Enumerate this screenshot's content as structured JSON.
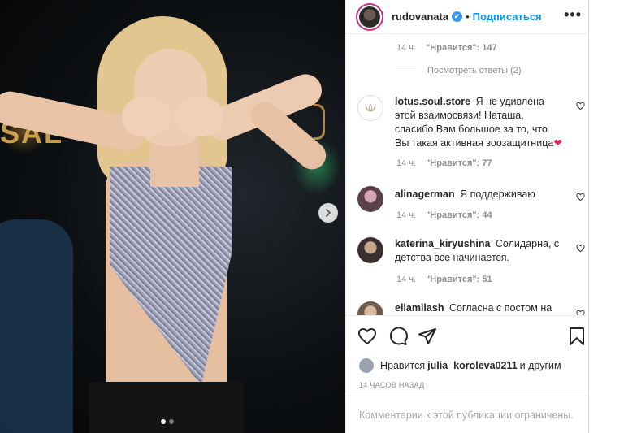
{
  "post": {
    "username": "rudovanata",
    "follow_label": "Подписаться",
    "separator": "•",
    "more_label": "•••",
    "verified_mark": "✔"
  },
  "photo": {
    "sign_text": "SAL",
    "carousel": {
      "count": 2,
      "active_index": 0
    }
  },
  "thread": {
    "first_meta": {
      "time": "14 ч.",
      "likes": "\"Нравится\": 147"
    },
    "view_replies": "Посмотреть ответы (2)",
    "comments": [
      {
        "user": "lotus.soul.store",
        "text": "Я не удивлена этой взаимосвязи! Наташа, спасибо Вам большое за то, что Вы такая активная зоозащитница",
        "emoji": "❤",
        "time": "14 ч.",
        "likes": "\"Нравится\": 77"
      },
      {
        "user": "alinagerman",
        "text": "Я поддерживаю",
        "time": "14 ч.",
        "likes": "\"Нравится\": 44"
      },
      {
        "user": "katerina_kiryushina",
        "text": "Солидарна, с детства все начинается.",
        "time": "14 ч.",
        "likes": "\"Нравится\": 51"
      },
      {
        "user": "ellamilash",
        "text": "Согласна с постом на"
      }
    ]
  },
  "likes": {
    "prefix": "Нравится",
    "user": "julia_koroleva0211",
    "suffix": "и другим"
  },
  "timestamp": "14 ЧАСОВ НАЗАД",
  "footer": {
    "notice": "Комментарии к этой публикации ограничены."
  },
  "icons": {
    "like": "heart-icon",
    "comment": "comment-icon",
    "share": "share-icon",
    "save": "bookmark-icon",
    "next": "chevron-right-icon"
  },
  "colors": {
    "link_blue": "#0095f6",
    "secondary_text": "#8e8e8e",
    "heart_red": "#e0245e"
  }
}
